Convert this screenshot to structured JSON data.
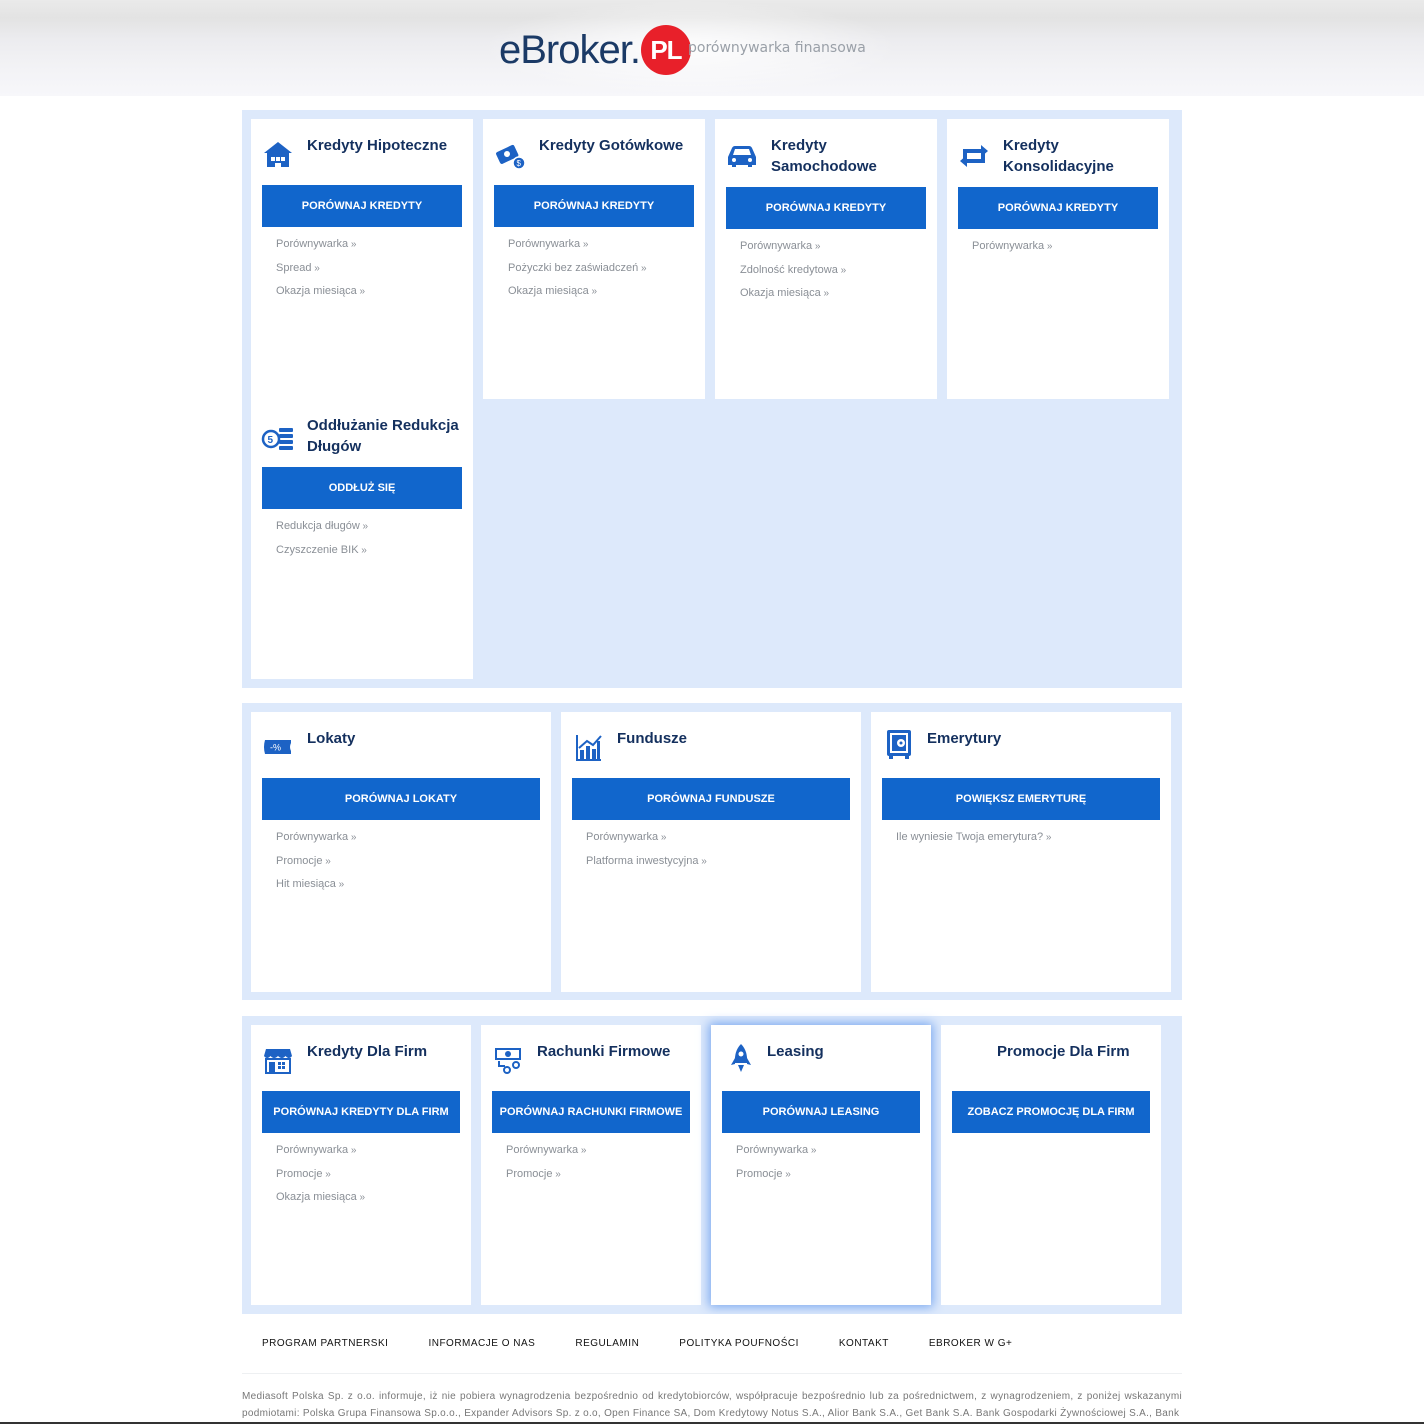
{
  "header": {
    "logo_text": "eBroker.",
    "logo_badge": "PL",
    "tagline": "porównywarka finansowa"
  },
  "section1": {
    "cards": [
      {
        "title": "Kredyty Hipoteczne",
        "icon": "house-icon",
        "button": "PORÓWNAJ KREDYTY",
        "links": [
          "Porównywarka",
          "Spread",
          "Okazja miesiąca"
        ]
      },
      {
        "title": "Kredyty Gotówkowe",
        "icon": "cash-icon",
        "button": "PORÓWNAJ KREDYTY",
        "links": [
          "Porównywarka",
          "Pożyczki bez zaświadczeń",
          "Okazja miesiąca"
        ]
      },
      {
        "title": "Kredyty Samochodowe",
        "icon": "car-icon",
        "button": "PORÓWNAJ KREDYTY",
        "links": [
          "Porównywarka",
          "Zdolność kredytowa",
          "Okazja miesiąca"
        ]
      },
      {
        "title": "Kredyty Konsolidacyjne",
        "icon": "refresh-icon",
        "button": "PORÓWNAJ KREDYTY",
        "links": [
          "Porównywarka"
        ]
      },
      {
        "title": "Oddłużanie Redukcja Długów",
        "icon": "coins-icon",
        "button": "ODDŁUŻ SIĘ",
        "links": [
          "Redukcja długów",
          "Czyszczenie BIK"
        ]
      }
    ]
  },
  "section2": {
    "cards": [
      {
        "title": "Lokaty",
        "icon": "percent-tag-icon",
        "button": "PORÓWNAJ LOKATY",
        "links": [
          "Porównywarka",
          "Promocje",
          "Hit miesiąca"
        ]
      },
      {
        "title": "Fundusze",
        "icon": "growth-chart-icon",
        "button": "PORÓWNAJ FUNDUSZE",
        "links": [
          "Porównywarka",
          "Platforma inwestycyjna"
        ]
      },
      {
        "title": "Emerytury",
        "icon": "safe-icon",
        "button": "POWIĘKSZ EMERYTURĘ",
        "links": [
          "Ile wyniesie Twoja emerytura?"
        ]
      }
    ]
  },
  "section3": {
    "cards": [
      {
        "title": "Kredyty Dla Firm",
        "icon": "shop-icon",
        "button": "PORÓWNAJ KREDYTY DLA FIRM",
        "links": [
          "Porównywarka",
          "Promocje",
          "Okazja miesiąca"
        ]
      },
      {
        "title": "Rachunki Firmowe",
        "icon": "account-icon",
        "button": "PORÓWNAJ RACHUNKI FIRMOWE",
        "links": [
          "Porównywarka",
          "Promocje"
        ]
      },
      {
        "title": "Leasing",
        "icon": "rocket-icon",
        "button": "PORÓWNAJ LEASING",
        "links": [
          "Porównywarka",
          "Promocje"
        ]
      },
      {
        "title": "Promocje Dla Firm",
        "icon": "",
        "button": "ZOBACZ PROMOCJĘ DLA FIRM",
        "links": []
      }
    ]
  },
  "footer": {
    "links": [
      "PROGRAM PARTNERSKI",
      "INFORMACJE O NAS",
      "REGULAMIN",
      "POLITYKA POUFNOŚCI",
      "KONTAKT",
      "EBROKER W G+"
    ],
    "disclaimer": "Mediasoft Polska Sp. z o.o. informuje, iż nie pobiera wynagrodzenia bezpośrednio od kredytobiorców, współpracuje bezpośrednio lub za pośrednictwem, z wynagrodzeniem, z poniżej wskazanymi podmiotami: Polska Grupa Finansowa Sp.o.o., Expander Advisors Sp. z o.o, Open Finance SA, Dom Kredytowy Notus S.A., Alior Bank S.A., Get Bank S.A. Bank Gospodarki Żywnościowej S.A., Bank"
  },
  "colors": {
    "accent": "#1166cc",
    "panel_bg": "#dde9fb",
    "title": "#14305e",
    "logo_red": "#e8202a"
  }
}
